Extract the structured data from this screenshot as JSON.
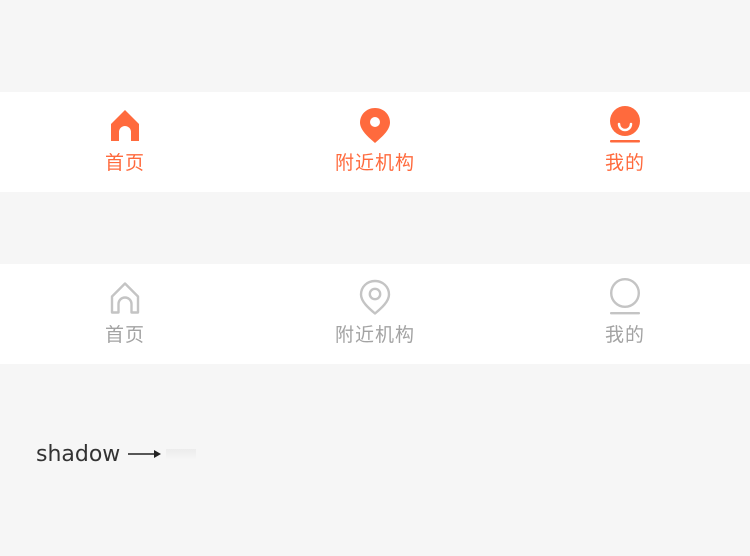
{
  "colors": {
    "accent": "#ff6a3d",
    "inactive": "#c4c4c4",
    "background": "#f6f6f6",
    "bar": "#ffffff"
  },
  "tabbar_active": {
    "tabs": [
      {
        "label": "首页",
        "icon": "home-icon"
      },
      {
        "label": "附近机构",
        "icon": "location-pin-icon"
      },
      {
        "label": "我的",
        "icon": "user-icon"
      }
    ]
  },
  "tabbar_inactive": {
    "tabs": [
      {
        "label": "首页",
        "icon": "home-icon"
      },
      {
        "label": "附近机构",
        "icon": "location-pin-icon"
      },
      {
        "label": "我的",
        "icon": "user-icon"
      }
    ]
  },
  "shadow_demo": {
    "label": "shadow"
  }
}
